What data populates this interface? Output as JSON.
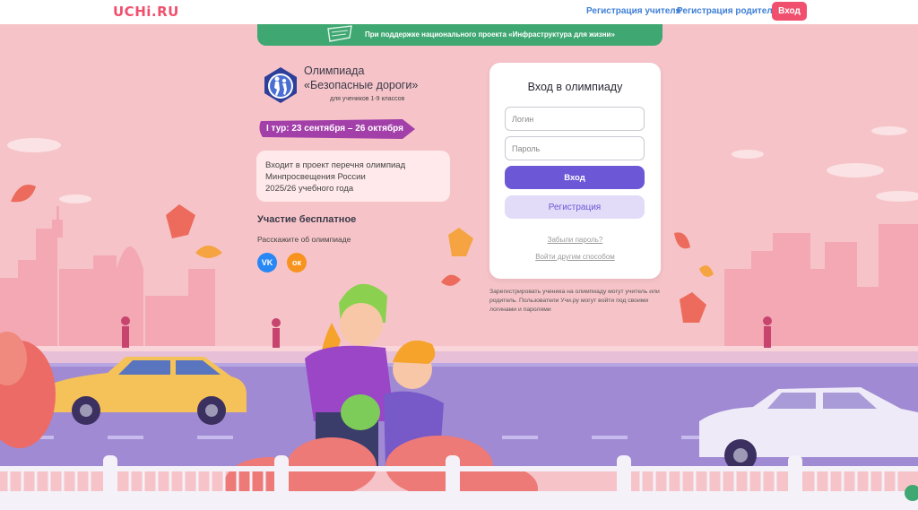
{
  "header": {
    "logo": "UCHi.RU",
    "teacher_registration": "Регистрация учителя",
    "parent_registration": "Регистрация родителя",
    "login_button": "Вход"
  },
  "banner": {
    "text": "При поддержке национального проекта «Инфраструктура для жизни»"
  },
  "olympiad": {
    "title_line1": "Олимпиада",
    "title_line2": "«Безопасные дороги»",
    "subtitle": "для учеников 1-9 классов",
    "round": "I тур: 23 сентября – 26 октября",
    "info_line1": "Входит в проект перечня олимпиад",
    "info_line2": "Минпросвещения России",
    "info_line3": "2025/26 учебного года",
    "free_participation": "Участие бесплатное",
    "share_prompt": "Расскажите об олимпиаде",
    "vk_label": "VK",
    "ok_label": "ок"
  },
  "login_card": {
    "title": "Вход в олимпиаду",
    "login_placeholder": "Логин",
    "password_placeholder": "Пароль",
    "enter_button": "Вход",
    "register_button": "Регистрация",
    "forgot_password": "Забыли пароль?",
    "other_login": "Войти другим способом",
    "note": "Зарегистрировать ученика на олимпиаду могут учитель или родитель. Пользователи Учи.ру могут войти под своими логинами и паролями"
  },
  "colors": {
    "brand": "#f0506e",
    "banner_green": "#3fa772",
    "primary_button": "#6c58d6",
    "secondary_button": "#e2dcf8",
    "ribbon": "#a33fa9",
    "background": "#f6c4c8"
  }
}
